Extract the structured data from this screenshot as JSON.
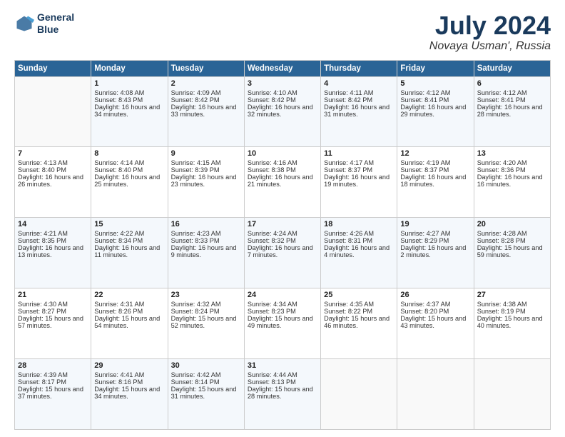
{
  "header": {
    "logo_line1": "General",
    "logo_line2": "Blue",
    "month": "July 2024",
    "location": "Novaya Usman', Russia"
  },
  "weekdays": [
    "Sunday",
    "Monday",
    "Tuesday",
    "Wednesday",
    "Thursday",
    "Friday",
    "Saturday"
  ],
  "weeks": [
    [
      {
        "day": "",
        "sunrise": "",
        "sunset": "",
        "daylight": ""
      },
      {
        "day": "1",
        "sunrise": "Sunrise: 4:08 AM",
        "sunset": "Sunset: 8:43 PM",
        "daylight": "Daylight: 16 hours and 34 minutes."
      },
      {
        "day": "2",
        "sunrise": "Sunrise: 4:09 AM",
        "sunset": "Sunset: 8:42 PM",
        "daylight": "Daylight: 16 hours and 33 minutes."
      },
      {
        "day": "3",
        "sunrise": "Sunrise: 4:10 AM",
        "sunset": "Sunset: 8:42 PM",
        "daylight": "Daylight: 16 hours and 32 minutes."
      },
      {
        "day": "4",
        "sunrise": "Sunrise: 4:11 AM",
        "sunset": "Sunset: 8:42 PM",
        "daylight": "Daylight: 16 hours and 31 minutes."
      },
      {
        "day": "5",
        "sunrise": "Sunrise: 4:12 AM",
        "sunset": "Sunset: 8:41 PM",
        "daylight": "Daylight: 16 hours and 29 minutes."
      },
      {
        "day": "6",
        "sunrise": "Sunrise: 4:12 AM",
        "sunset": "Sunset: 8:41 PM",
        "daylight": "Daylight: 16 hours and 28 minutes."
      }
    ],
    [
      {
        "day": "7",
        "sunrise": "Sunrise: 4:13 AM",
        "sunset": "Sunset: 8:40 PM",
        "daylight": "Daylight: 16 hours and 26 minutes."
      },
      {
        "day": "8",
        "sunrise": "Sunrise: 4:14 AM",
        "sunset": "Sunset: 8:40 PM",
        "daylight": "Daylight: 16 hours and 25 minutes."
      },
      {
        "day": "9",
        "sunrise": "Sunrise: 4:15 AM",
        "sunset": "Sunset: 8:39 PM",
        "daylight": "Daylight: 16 hours and 23 minutes."
      },
      {
        "day": "10",
        "sunrise": "Sunrise: 4:16 AM",
        "sunset": "Sunset: 8:38 PM",
        "daylight": "Daylight: 16 hours and 21 minutes."
      },
      {
        "day": "11",
        "sunrise": "Sunrise: 4:17 AM",
        "sunset": "Sunset: 8:37 PM",
        "daylight": "Daylight: 16 hours and 19 minutes."
      },
      {
        "day": "12",
        "sunrise": "Sunrise: 4:19 AM",
        "sunset": "Sunset: 8:37 PM",
        "daylight": "Daylight: 16 hours and 18 minutes."
      },
      {
        "day": "13",
        "sunrise": "Sunrise: 4:20 AM",
        "sunset": "Sunset: 8:36 PM",
        "daylight": "Daylight: 16 hours and 16 minutes."
      }
    ],
    [
      {
        "day": "14",
        "sunrise": "Sunrise: 4:21 AM",
        "sunset": "Sunset: 8:35 PM",
        "daylight": "Daylight: 16 hours and 13 minutes."
      },
      {
        "day": "15",
        "sunrise": "Sunrise: 4:22 AM",
        "sunset": "Sunset: 8:34 PM",
        "daylight": "Daylight: 16 hours and 11 minutes."
      },
      {
        "day": "16",
        "sunrise": "Sunrise: 4:23 AM",
        "sunset": "Sunset: 8:33 PM",
        "daylight": "Daylight: 16 hours and 9 minutes."
      },
      {
        "day": "17",
        "sunrise": "Sunrise: 4:24 AM",
        "sunset": "Sunset: 8:32 PM",
        "daylight": "Daylight: 16 hours and 7 minutes."
      },
      {
        "day": "18",
        "sunrise": "Sunrise: 4:26 AM",
        "sunset": "Sunset: 8:31 PM",
        "daylight": "Daylight: 16 hours and 4 minutes."
      },
      {
        "day": "19",
        "sunrise": "Sunrise: 4:27 AM",
        "sunset": "Sunset: 8:29 PM",
        "daylight": "Daylight: 16 hours and 2 minutes."
      },
      {
        "day": "20",
        "sunrise": "Sunrise: 4:28 AM",
        "sunset": "Sunset: 8:28 PM",
        "daylight": "Daylight: 15 hours and 59 minutes."
      }
    ],
    [
      {
        "day": "21",
        "sunrise": "Sunrise: 4:30 AM",
        "sunset": "Sunset: 8:27 PM",
        "daylight": "Daylight: 15 hours and 57 minutes."
      },
      {
        "day": "22",
        "sunrise": "Sunrise: 4:31 AM",
        "sunset": "Sunset: 8:26 PM",
        "daylight": "Daylight: 15 hours and 54 minutes."
      },
      {
        "day": "23",
        "sunrise": "Sunrise: 4:32 AM",
        "sunset": "Sunset: 8:24 PM",
        "daylight": "Daylight: 15 hours and 52 minutes."
      },
      {
        "day": "24",
        "sunrise": "Sunrise: 4:34 AM",
        "sunset": "Sunset: 8:23 PM",
        "daylight": "Daylight: 15 hours and 49 minutes."
      },
      {
        "day": "25",
        "sunrise": "Sunrise: 4:35 AM",
        "sunset": "Sunset: 8:22 PM",
        "daylight": "Daylight: 15 hours and 46 minutes."
      },
      {
        "day": "26",
        "sunrise": "Sunrise: 4:37 AM",
        "sunset": "Sunset: 8:20 PM",
        "daylight": "Daylight: 15 hours and 43 minutes."
      },
      {
        "day": "27",
        "sunrise": "Sunrise: 4:38 AM",
        "sunset": "Sunset: 8:19 PM",
        "daylight": "Daylight: 15 hours and 40 minutes."
      }
    ],
    [
      {
        "day": "28",
        "sunrise": "Sunrise: 4:39 AM",
        "sunset": "Sunset: 8:17 PM",
        "daylight": "Daylight: 15 hours and 37 minutes."
      },
      {
        "day": "29",
        "sunrise": "Sunrise: 4:41 AM",
        "sunset": "Sunset: 8:16 PM",
        "daylight": "Daylight: 15 hours and 34 minutes."
      },
      {
        "day": "30",
        "sunrise": "Sunrise: 4:42 AM",
        "sunset": "Sunset: 8:14 PM",
        "daylight": "Daylight: 15 hours and 31 minutes."
      },
      {
        "day": "31",
        "sunrise": "Sunrise: 4:44 AM",
        "sunset": "Sunset: 8:13 PM",
        "daylight": "Daylight: 15 hours and 28 minutes."
      },
      {
        "day": "",
        "sunrise": "",
        "sunset": "",
        "daylight": ""
      },
      {
        "day": "",
        "sunrise": "",
        "sunset": "",
        "daylight": ""
      },
      {
        "day": "",
        "sunrise": "",
        "sunset": "",
        "daylight": ""
      }
    ]
  ]
}
